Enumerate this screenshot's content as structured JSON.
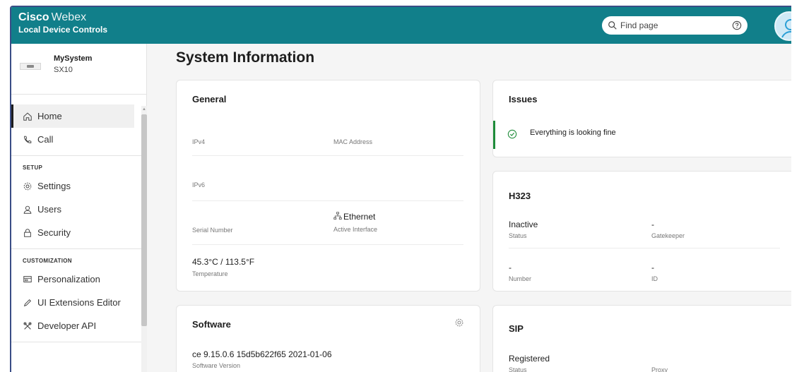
{
  "app": {
    "brand_bold": "Cisco",
    "brand_light": "Webex",
    "subtitle": "Local Device Controls"
  },
  "search": {
    "placeholder": "Find page"
  },
  "sidebar": {
    "device": {
      "name": "MySystem",
      "model": "SX10"
    },
    "items_top": [
      {
        "label": "Home",
        "icon": "home-icon",
        "active": true
      },
      {
        "label": "Call",
        "icon": "phone-icon"
      }
    ],
    "setup_header": "SETUP",
    "setup_items": [
      {
        "label": "Settings",
        "icon": "gear-icon"
      },
      {
        "label": "Users",
        "icon": "user-icon"
      },
      {
        "label": "Security",
        "icon": "lock-icon"
      }
    ],
    "custom_header": "CUSTOMIZATION",
    "custom_items": [
      {
        "label": "Personalization",
        "icon": "monitor-icon"
      },
      {
        "label": "UI Extensions Editor",
        "icon": "pencil-icon"
      },
      {
        "label": "Developer API",
        "icon": "tools-icon"
      }
    ]
  },
  "main": {
    "title": "System Information",
    "general": {
      "title": "General",
      "ipv4_label": "IPv4",
      "mac_label": "MAC Address",
      "ipv6_label": "IPv6",
      "serial_label": "Serial Number",
      "interface_value": "Ethernet",
      "interface_label": "Active Interface",
      "temperature_value": "45.3°C / 113.5°F",
      "temperature_label": "Temperature"
    },
    "issues": {
      "title": "Issues",
      "message": "Everything is looking fine",
      "status_color": "#1f8c3a"
    },
    "h323": {
      "title": "H323",
      "status_value": "Inactive",
      "status_label": "Status",
      "gatekeeper_value": "-",
      "gatekeeper_label": "Gatekeeper",
      "number_value": "-",
      "number_label": "Number",
      "id_value": "-",
      "id_label": "ID"
    },
    "software": {
      "title": "Software",
      "version_value": "ce 9.15.0.6 15d5b622f65 2021-01-06",
      "version_label": "Software Version"
    },
    "sip": {
      "title": "SIP",
      "status_value": "Registered",
      "status_label": "Status",
      "proxy_label": "Proxy"
    }
  },
  "colors": {
    "topbar": "#117f8a",
    "frame_border": "#3a4d86",
    "ok_green": "#1f8c3a"
  }
}
